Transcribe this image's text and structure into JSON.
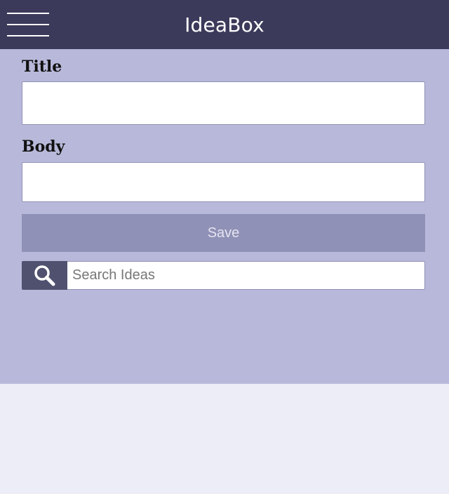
{
  "header": {
    "app_title": "IdeaBox",
    "menu_icon": "hamburger-menu-icon"
  },
  "form": {
    "title_label": "Title",
    "title_value": "",
    "body_label": "Body",
    "body_value": "",
    "save_label": "Save"
  },
  "search": {
    "icon": "search-icon",
    "placeholder": "Search Ideas",
    "value": ""
  },
  "colors": {
    "header_bg": "#3b3a5a",
    "panel_bg": "#b8b9da",
    "save_button_bg": "#9091b6",
    "search_icon_bg": "#50506f",
    "page_bg": "#ecedf6"
  }
}
